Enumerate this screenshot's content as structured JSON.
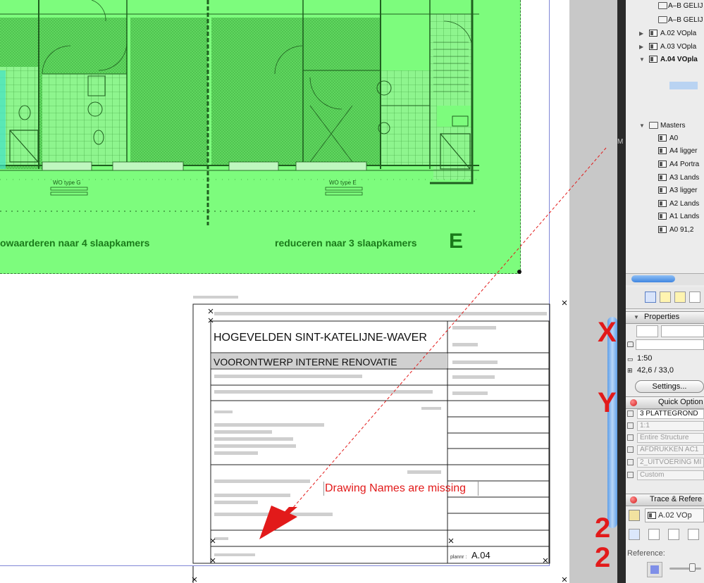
{
  "canvas": {
    "drawing": {
      "caption_left": "owaarderen naar 4 slaapkamers",
      "caption_right": "reduceren naar 3 slaapkamers",
      "zone_letter": "E",
      "unit_left": "WO type G",
      "unit_right": "WO type E"
    },
    "title_block": {
      "project": "HOGEVELDEN  SINT-KATELIJNE-WAVER",
      "phase": "VOORONTWERP   INTERNE RENOVATIE",
      "plan_label": "plannr :",
      "plan_number": "A.04"
    },
    "annotation": {
      "text": "Drawing Names are missing",
      "color": "#e21a1a"
    }
  },
  "navigator": {
    "tree": [
      {
        "label": "A–B GELIJ",
        "type": "folder"
      },
      {
        "label": "A–B GELIJ",
        "type": "folder"
      },
      {
        "label": "A.02  VOpla",
        "type": "sheet",
        "collapsed": true
      },
      {
        "label": "A.03  VOpla",
        "type": "sheet",
        "collapsed": true
      },
      {
        "label": "A.04  VOpla",
        "type": "sheet",
        "expanded": true,
        "bold": true
      },
      {
        "label": "Masters",
        "type": "folder",
        "expanded": true
      },
      {
        "label": "A0",
        "type": "master"
      },
      {
        "label": "A4 ligger",
        "type": "master"
      },
      {
        "label": "A4 Portra",
        "type": "master"
      },
      {
        "label": "A3 Lands",
        "type": "master"
      },
      {
        "label": "A3 ligger",
        "type": "master"
      },
      {
        "label": "A2 Lands",
        "type": "master"
      },
      {
        "label": "A1 Lands",
        "type": "master"
      },
      {
        "label": "A0 91,2",
        "type": "master"
      }
    ]
  },
  "properties": {
    "header": "Properties",
    "scale": "1:50",
    "size": "42,6 / 33,0",
    "settings_button": "Settings..."
  },
  "quick_options": {
    "header": "Quick Option",
    "rows": [
      "3   PLATTEGROND",
      "1:1",
      "Entire Structure",
      "AFDRUKKEN AC1",
      "2_UITVOERING MI",
      "Custom"
    ]
  },
  "trace": {
    "header": "Trace & Refere",
    "value": "A.02  VOp",
    "reference_label": "Reference:"
  },
  "stray_edge_letter": "M",
  "colors": {
    "drawing_fill": "#7dfc7d",
    "accent_blue": "#5f9fe8",
    "annotation_red": "#e21a1a"
  }
}
